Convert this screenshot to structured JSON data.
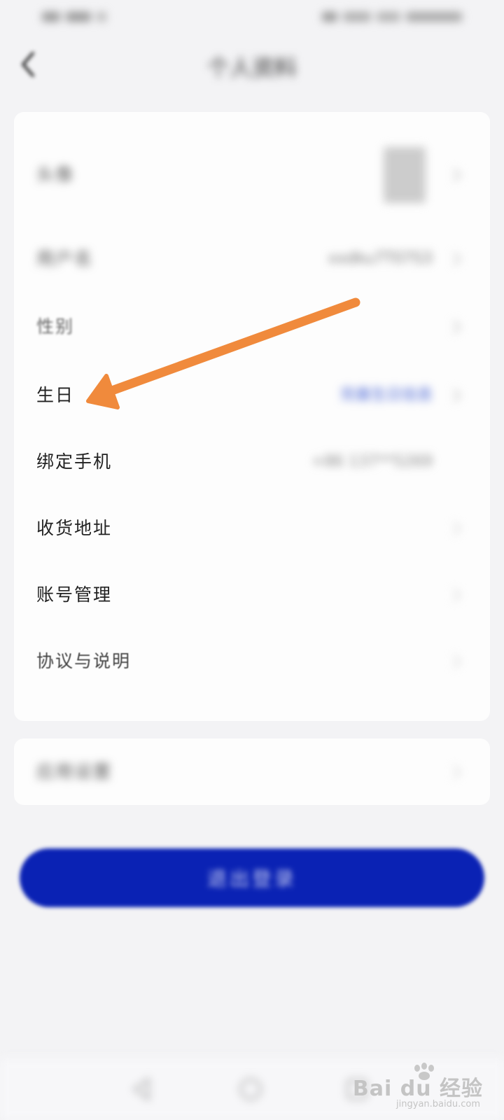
{
  "header": {
    "title": "个人资料"
  },
  "profile_rows": [
    {
      "label": "头像",
      "value": ""
    },
    {
      "label": "用户名",
      "value": "xxdku7T07S3"
    },
    {
      "label": "性别",
      "value": ""
    },
    {
      "label": "生日",
      "value": "完善生日信息"
    },
    {
      "label": "绑定手机",
      "value": "+86 137**5269"
    },
    {
      "label": "收货地址",
      "value": ""
    },
    {
      "label": "账号管理",
      "value": ""
    },
    {
      "label": "协议与说明",
      "value": ""
    }
  ],
  "secondary_rows": [
    {
      "label": "应用设置"
    }
  ],
  "primary_button": {
    "label": "退出登录"
  },
  "watermark": {
    "main": "Bai du 经验",
    "sub": "jingyan.baidu.com"
  },
  "colors": {
    "primary": "#0a22b4",
    "annotation_arrow": "#f08a3c",
    "link_blue": "#4a66d6"
  }
}
